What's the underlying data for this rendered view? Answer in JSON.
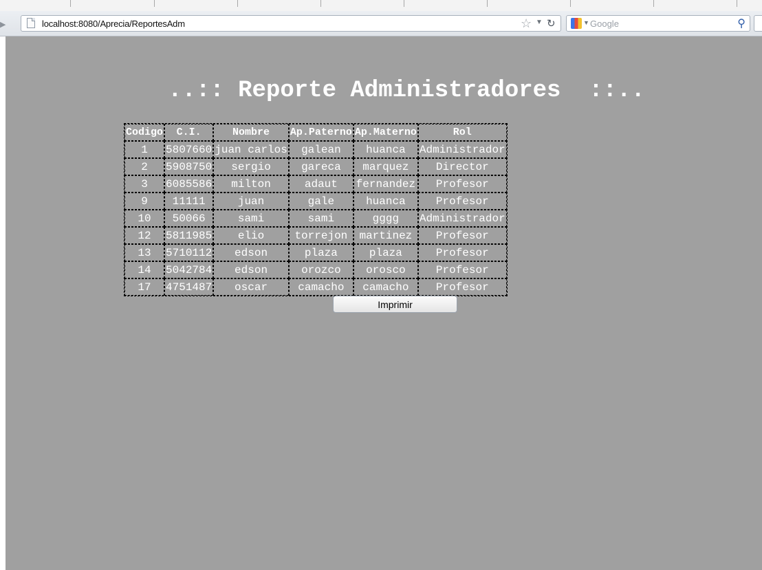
{
  "browser": {
    "url": "localhost:8080/Aprecia/ReportesAdm",
    "search_placeholder": "Google"
  },
  "report": {
    "title": "..:: Reporte Administradores  ::..",
    "columns": [
      "Codigo",
      "C.I.",
      "Nombre",
      "Ap.Paterno",
      "Ap.Materno",
      "Rol"
    ],
    "rows": [
      [
        "1",
        "5807660",
        "juan carlos",
        "galean",
        "huanca",
        "Administrador"
      ],
      [
        "2",
        "5908750",
        "sergio",
        "gareca",
        "marquez",
        "Director"
      ],
      [
        "3",
        "6085586",
        "milton",
        "adaut",
        "fernandez",
        "Profesor"
      ],
      [
        "9",
        "11111",
        "juan",
        "gale",
        "huanca",
        "Profesor"
      ],
      [
        "10",
        "50066",
        "sami",
        "sami",
        "gggg",
        "Administrador"
      ],
      [
        "12",
        "5811985",
        "elio",
        "torrejon",
        "martinez",
        "Profesor"
      ],
      [
        "13",
        "5710112",
        "edson",
        "plaza",
        "plaza",
        "Profesor"
      ],
      [
        "14",
        "5042784",
        "edson",
        "orozco",
        "orosco",
        "Profesor"
      ],
      [
        "17",
        "4751487",
        "oscar",
        "camacho",
        "camacho",
        "Profesor"
      ]
    ],
    "print_label": "Imprimir"
  },
  "colors": {
    "page_background": "#a0a0a0",
    "text": "#ffffff"
  }
}
